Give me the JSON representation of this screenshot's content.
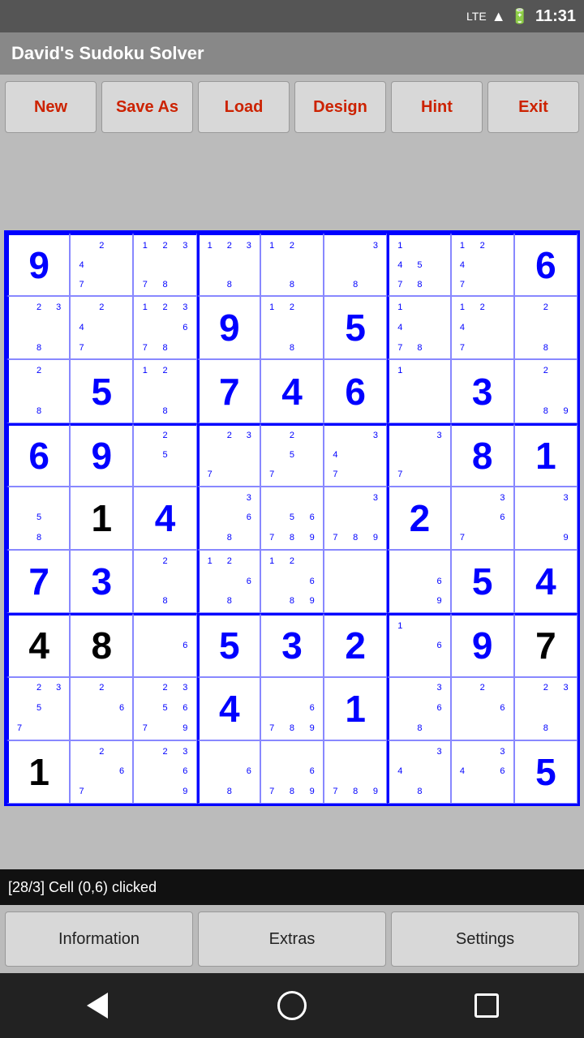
{
  "statusBar": {
    "time": "11:31",
    "batteryIcon": "🔋",
    "signalIcon": "LTE"
  },
  "titleBar": {
    "title": "David's Sudoku Solver"
  },
  "toolbar": {
    "buttons": [
      "New",
      "Save As",
      "Load",
      "Design",
      "Hint",
      "Exit"
    ]
  },
  "statusLine": {
    "text": "[28/3] Cell (0,6) clicked"
  },
  "bottomButtons": [
    "Information",
    "Extras",
    "Settings"
  ],
  "grid": {
    "cells": [
      [
        {
          "big": "9",
          "color": "blue"
        },
        {
          "small": "2\n4\n7"
        },
        {
          "small": "1 2 3\n7 8"
        },
        {
          "small": "1 2 3\n8"
        },
        {
          "small": "1 2\n8"
        },
        {
          "small": "3\n8"
        },
        {
          "small": "1\n4 5\n7 8"
        },
        {
          "small": "1 2\n4\n7"
        },
        {
          "big": "6",
          "color": "blue"
        }
      ],
      [
        {
          "small": "2 3\n8"
        },
        {
          "small": "2\n4\n7"
        },
        {
          "small": "1 2 3\n6\n7 8"
        },
        {
          "big": "9",
          "color": "blue"
        },
        {
          "small": "1 2\n8"
        },
        {
          "big": "5",
          "color": "blue"
        },
        {
          "small": "1\n4\n7 8"
        },
        {
          "small": "1 2\n4\n7"
        },
        {
          "small": "2\n8"
        }
      ],
      [
        {
          "small": "2\n8"
        },
        {
          "big": "5",
          "color": "blue"
        },
        {
          "small": "1 2\n8"
        },
        {
          "big": "7",
          "color": "blue"
        },
        {
          "big": "4",
          "color": "blue"
        },
        {
          "big": "6",
          "color": "blue"
        },
        {
          "small": "1"
        },
        {
          "big": "3",
          "color": "blue"
        },
        {
          "small": "2\n8 9"
        }
      ],
      [
        {
          "big": "6",
          "color": "blue"
        },
        {
          "big": "9",
          "color": "blue"
        },
        {
          "small": "2\n5"
        },
        {
          "small": "2 3\n7"
        },
        {
          "small": "2\n5\n7"
        },
        {
          "small": "3\n4\n7"
        },
        {
          "small": "3\n7"
        },
        {
          "big": "8",
          "color": "blue"
        },
        {
          "big": "1",
          "color": "blue"
        }
      ],
      [
        {
          "small": "5\n8"
        },
        {
          "big": "1",
          "color": "black"
        },
        {
          "big": "4",
          "color": "blue"
        },
        {
          "small": "3\n6\n8"
        },
        {
          "small": "5 6\n7 8 9"
        },
        {
          "small": "3\n7 8 9"
        },
        {
          "big": "2",
          "color": "blue"
        },
        {
          "small": "3\n6\n7"
        },
        {
          "small": "3\n9"
        }
      ],
      [
        {
          "big": "7",
          "color": "blue"
        },
        {
          "big": "3",
          "color": "blue"
        },
        {
          "small": "2\n8"
        },
        {
          "small": "1 2\n6\n8"
        },
        {
          "small": "1 2\n6\n8 9"
        },
        {
          "small": ""
        },
        {
          "small": "6\n9"
        },
        {
          "big": "5",
          "color": "blue"
        },
        {
          "big": "4",
          "color": "blue"
        }
      ],
      [
        {
          "big": "4",
          "color": "black"
        },
        {
          "big": "8",
          "color": "black"
        },
        {
          "small": "6"
        },
        {
          "big": "5",
          "color": "blue"
        },
        {
          "big": "3",
          "color": "blue"
        },
        {
          "big": "2",
          "color": "blue"
        },
        {
          "small": "1\n6"
        },
        {
          "big": "9",
          "color": "blue"
        },
        {
          "big": "7",
          "color": "black"
        }
      ],
      [
        {
          "small": "2 3\n5\n7"
        },
        {
          "small": "2\n6"
        },
        {
          "small": "2 3\n5 6\n7 9"
        },
        {
          "big": "4",
          "color": "blue"
        },
        {
          "small": "6\n7 8 9"
        },
        {
          "big": "1",
          "color": "blue"
        },
        {
          "small": "3\n6\n8"
        },
        {
          "small": "2\n6"
        },
        {
          "small": "2 3\n8"
        }
      ],
      [
        {
          "big": "1",
          "color": "black"
        },
        {
          "small": "2\n6\n7"
        },
        {
          "small": "2 3\n6\n9"
        },
        {
          "small": "6\n8"
        },
        {
          "small": "6\n7 8 9"
        },
        {
          "small": "7 8 9"
        },
        {
          "small": "3\n4\n8"
        },
        {
          "small": "3\n4 6"
        },
        {
          "big": "5",
          "color": "blue"
        }
      ]
    ]
  }
}
